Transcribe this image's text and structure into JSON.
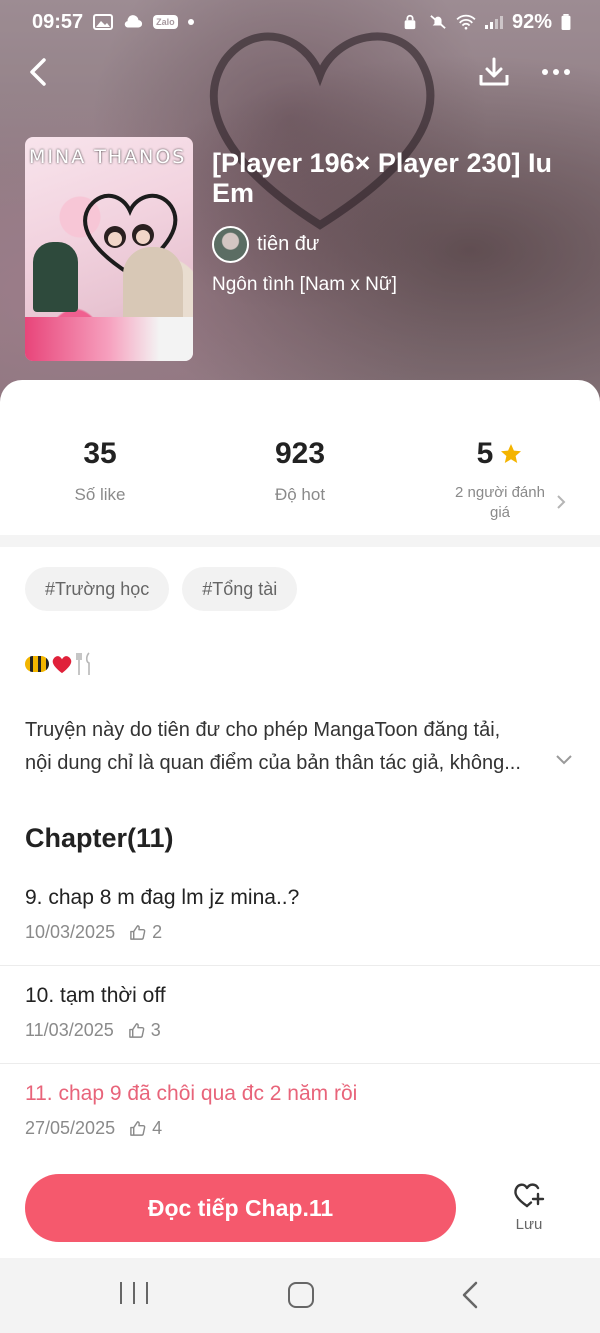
{
  "status_bar": {
    "time": "09:57",
    "zalo": "Zalo",
    "battery": "92%"
  },
  "book": {
    "title": "[Player 196× Player 230] Iu Em",
    "author": "tiên đư",
    "genre": "Ngôn tình [Nam x Nữ]",
    "cover_text": "MINA THANOS"
  },
  "stats": {
    "likes_value": "35",
    "likes_label": "Số like",
    "hot_value": "923",
    "hot_label": "Độ hot",
    "rating_value": "5",
    "rating_label": "2 người đánh giá"
  },
  "tags": [
    "#Trường học",
    "#Tổng tài"
  ],
  "description": {
    "line1": "Truyện này do tiên đư  cho phép MangaToon đăng tải,",
    "line2": "nội dung chỉ là quan điểm của bản thân tác giả, không..."
  },
  "chapters": {
    "heading": "Chapter(11)",
    "items": [
      {
        "title": "9. chap 8 m đag lm jz mina..?",
        "date": "10/03/2025",
        "likes": "2",
        "current": false
      },
      {
        "title": "10. tạm thời off",
        "date": "11/03/2025",
        "likes": "3",
        "current": false
      },
      {
        "title": "11. chap 9 đã chôi qua đc 2 năm rồi",
        "date": "27/05/2025",
        "likes": "4",
        "current": true
      }
    ]
  },
  "actions": {
    "read_label": "Đọc tiếp Chap.11",
    "save_label": "Lưu"
  },
  "icons": {
    "back": "back-chevron-icon",
    "download": "download-icon",
    "more": "more-dots-icon",
    "star": "star-icon",
    "thumb": "thumb-up-icon",
    "save": "heart-plus-icon"
  },
  "colors": {
    "accent": "#f5596d",
    "current_chapter": "#e8647a",
    "star": "#f4b400"
  }
}
